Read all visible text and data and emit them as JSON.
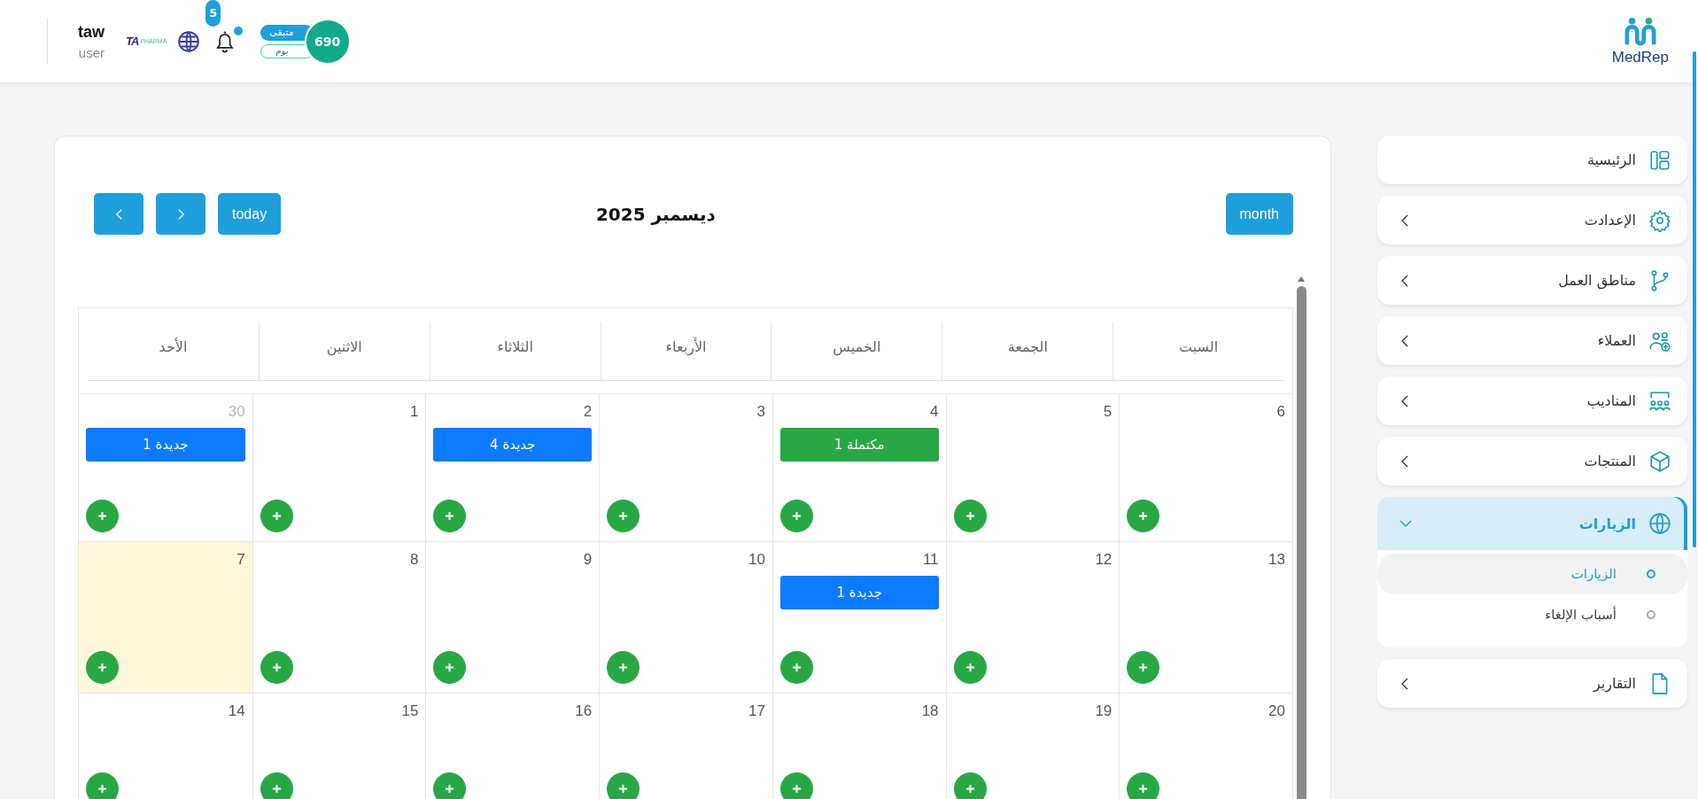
{
  "header": {
    "user": {
      "name": "taw",
      "role": "user"
    },
    "company_logo": {
      "mark": "TA",
      "text": "PHARMA"
    },
    "notifications": {
      "count": "5",
      "unread": true
    },
    "remaining": {
      "label": "متبقى",
      "unit": "يوم",
      "value": "690"
    },
    "brand": {
      "text": "MedRep"
    }
  },
  "calendar": {
    "title": "ديسمبر 2025",
    "today_button": "today",
    "view_button": "month",
    "weekdays": [
      "السبت",
      "الجمعة",
      "الخميس",
      "الأربعاء",
      "الثلاثاء",
      "الاثنين",
      "الأحد"
    ],
    "weeks": [
      [
        {
          "day": "6"
        },
        {
          "day": "5"
        },
        {
          "day": "4",
          "events": [
            {
              "label": "مكتملة 1",
              "color": "#28a745"
            }
          ]
        },
        {
          "day": "3"
        },
        {
          "day": "2",
          "events": [
            {
              "label": "جديدة 4",
              "color": "#0d7bff"
            }
          ]
        },
        {
          "day": "1"
        },
        {
          "day": "30",
          "other_month": true,
          "events": [
            {
              "label": "جديدة 1",
              "color": "#0d7bff"
            }
          ]
        }
      ],
      [
        {
          "day": "13"
        },
        {
          "day": "12"
        },
        {
          "day": "11",
          "events": [
            {
              "label": "جديدة 1",
              "color": "#0d7bff"
            }
          ]
        },
        {
          "day": "10"
        },
        {
          "day": "9"
        },
        {
          "day": "8"
        },
        {
          "day": "7",
          "today": true
        }
      ],
      [
        {
          "day": "20"
        },
        {
          "day": "19"
        },
        {
          "day": "18"
        },
        {
          "day": "17"
        },
        {
          "day": "16"
        },
        {
          "day": "15"
        },
        {
          "day": "14"
        }
      ]
    ]
  },
  "sidebar": {
    "items": [
      {
        "label": "الرئيسية",
        "selected": false
      },
      {
        "label": "الإعدادت",
        "expanded": false,
        "selected": false
      },
      {
        "label": "مناطق العمل",
        "expanded": false,
        "selected": false
      },
      {
        "label": "العملاء",
        "expanded": false,
        "selected": false
      },
      {
        "label": "المناديب",
        "expanded": false,
        "selected": false
      },
      {
        "label": "المنتجات",
        "expanded": false,
        "selected": false
      },
      {
        "label": "الزيارات",
        "expanded": true,
        "selected": true,
        "children": [
          {
            "label": "الزيارات",
            "selected": true
          },
          {
            "label": "أسباب الإلغاء",
            "selected": false
          }
        ]
      },
      {
        "label": "التقارير",
        "expanded": false,
        "selected": false
      }
    ]
  }
}
